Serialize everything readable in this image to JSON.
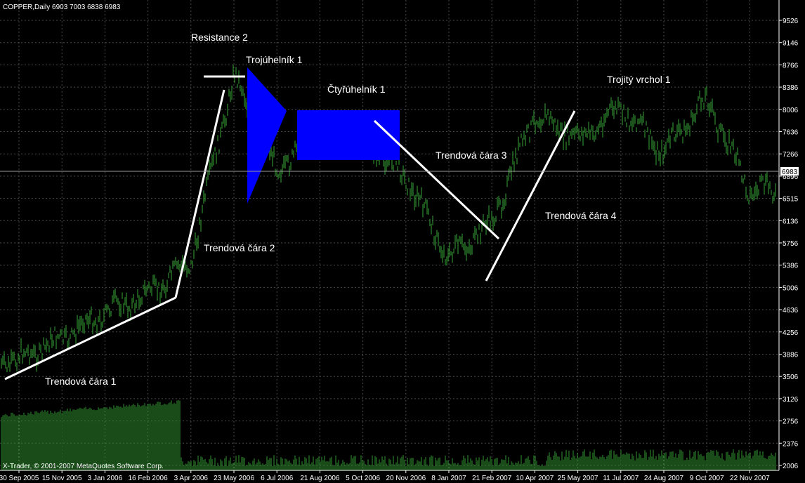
{
  "header": {
    "symbol_line": "COPPER,Daily  6903 7003 6838 6983"
  },
  "footer": {
    "copyright": "X-Trader, © 2001-2007 MetaQuotes Software Corp."
  },
  "price_label": "6983",
  "colors": {
    "background": "#000000",
    "grid": "#4a4a4a",
    "price": "#2e8b2e",
    "volume": "#2e8b2e",
    "trendline": "#ffffff",
    "shape_fill": "#0000ff",
    "text": "#ffffff"
  },
  "chart_data": {
    "type": "line",
    "title": "COPPER,Daily",
    "y_ticks": [
      "9526",
      "9146",
      "8766",
      "8386",
      "8006",
      "7636",
      "7266",
      "6896",
      "6515",
      "6136",
      "5756",
      "5386",
      "5006",
      "4636",
      "4256",
      "3886",
      "3506",
      "3126",
      "2756",
      "2376",
      "2006"
    ],
    "x_ticks": [
      "30 Sep 2005",
      "15 Nov 2005",
      "3 Jan 2006",
      "16 Feb 2006",
      "3 Apr 2006",
      "23 May 2006",
      "6 Jul 2006",
      "21 Aug 2006",
      "5 Oct 2006",
      "20 Nov 2006",
      "8 Jan 2007",
      "21 Feb 2007",
      "10 Apr 2007",
      "25 May 2007",
      "11 Jul 2007",
      "24 Aug 2007",
      "9 Oct 2007",
      "22 Nov 2007"
    ],
    "ylim": [
      2006,
      9526
    ],
    "last_price": 6983,
    "price_path": [
      {
        "x": "30 Sep 2005",
        "y": 3800
      },
      {
        "x": "15 Nov 2005",
        "y": 4150
      },
      {
        "x": "3 Jan 2006",
        "y": 4600
      },
      {
        "x": "16 Feb 2006",
        "y": 4900
      },
      {
        "x": "3 Apr 2006",
        "y": 5450
      },
      {
        "x": "23 May 2006",
        "y": 8600
      },
      {
        "x": "6 Jul 2006",
        "y": 7000
      },
      {
        "x": "21 Aug 2006",
        "y": 7600
      },
      {
        "x": "5 Oct 2006",
        "y": 7500
      },
      {
        "x": "20 Nov 2006",
        "y": 6900
      },
      {
        "x": "8 Jan 2007",
        "y": 5500
      },
      {
        "x": "21 Feb 2007",
        "y": 6100
      },
      {
        "x": "10 Apr 2007",
        "y": 7950
      },
      {
        "x": "25 May 2007",
        "y": 7500
      },
      {
        "x": "11 Jul 2007",
        "y": 8050
      },
      {
        "x": "24 Aug 2007",
        "y": 7300
      },
      {
        "x": "9 Oct 2007",
        "y": 8200
      },
      {
        "x": "22 Nov 2007",
        "y": 6650
      }
    ],
    "annotations": [
      {
        "id": "trend1",
        "text": "Trendová čára 1"
      },
      {
        "id": "trend2",
        "text": "Trendová čára 2"
      },
      {
        "id": "resistance2",
        "text": "Resistance 2"
      },
      {
        "id": "triangle1",
        "text": "Trojúhelník 1"
      },
      {
        "id": "rect1",
        "text": "Čtyřúhelník 1"
      },
      {
        "id": "trend3",
        "text": "Trendová čára 3"
      },
      {
        "id": "trend4",
        "text": "Trendová čára 4"
      },
      {
        "id": "triple_top",
        "text": "Trojitý vrchol 1"
      }
    ],
    "grid": true
  }
}
